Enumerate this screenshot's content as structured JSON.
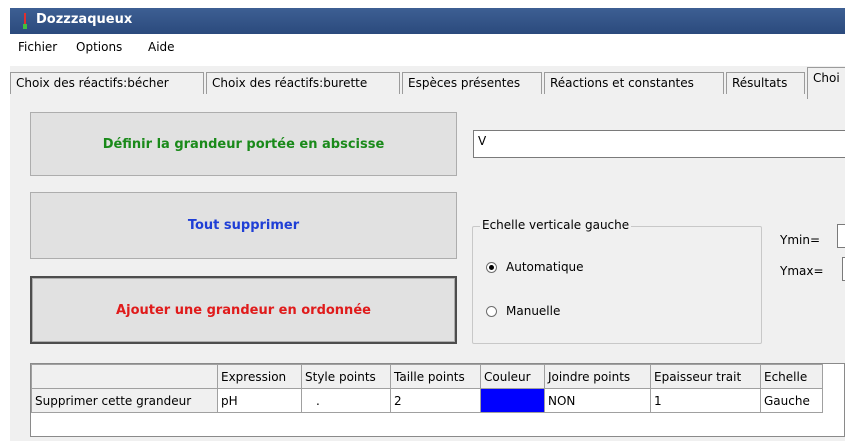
{
  "window": {
    "title": "Dozzzaqueux"
  },
  "menu": {
    "items": [
      "Fichier",
      "Options",
      "Aide"
    ]
  },
  "tabs": [
    {
      "label": "Choix des réactifs:bécher"
    },
    {
      "label": "Choix des réactifs:burette"
    },
    {
      "label": "Espèces présentes"
    },
    {
      "label": "Réactions et constantes"
    },
    {
      "label": "Résultats"
    },
    {
      "label": "Choi"
    }
  ],
  "buttons": {
    "define_abscissa": {
      "label": "Définir la grandeur portée en abscisse",
      "color": "#1a8a1a"
    },
    "delete_all": {
      "label": "Tout supprimer",
      "color": "#1f3fd6"
    },
    "add_ordinate": {
      "label": "Ajouter une grandeur en ordonnée",
      "color": "#e01b1b"
    }
  },
  "abscissa_input": {
    "value": "V"
  },
  "vertical_scale": {
    "legend": "Echelle verticale gauche",
    "options": [
      {
        "label": "Automatique",
        "checked": true
      },
      {
        "label": "Manuelle",
        "checked": false
      }
    ],
    "ymin_label": "Ymin=",
    "ymax_label": "Ymax="
  },
  "grid": {
    "headers": [
      "",
      "Expression",
      "Style points",
      "Taille points",
      "Couleur",
      "Joindre points",
      "Epaisseur trait",
      "Echelle"
    ],
    "rows": [
      [
        "Supprimer cette grandeur",
        "pH",
        ".",
        "2",
        "",
        "NON",
        "1",
        "Gauche"
      ]
    ],
    "color_swatch": "#0000ff"
  }
}
